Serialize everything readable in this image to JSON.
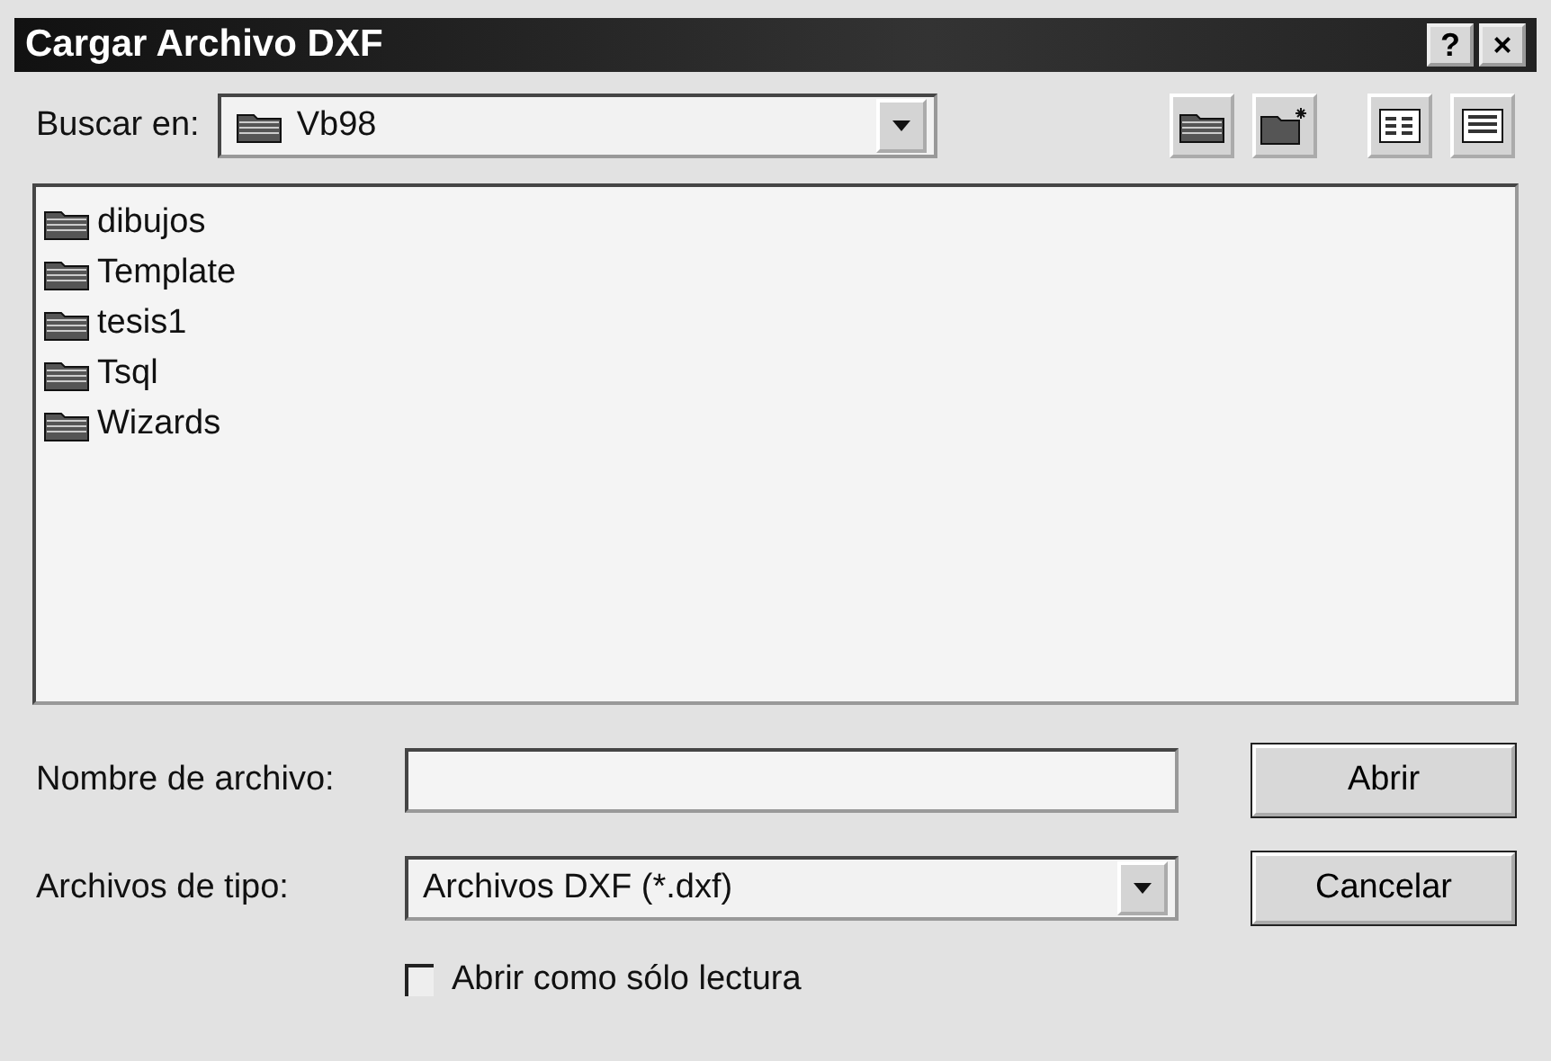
{
  "window": {
    "title": "Cargar Archivo DXF",
    "buttons": [
      "?",
      "×"
    ]
  },
  "look_in": {
    "label": "Buscar en:",
    "value": "Vb98"
  },
  "files": [
    {
      "name": "dibujos"
    },
    {
      "name": "Template"
    },
    {
      "name": "tesis1"
    },
    {
      "name": "Tsql"
    },
    {
      "name": "Wizards"
    }
  ],
  "file_name": {
    "label": "Nombre de archivo:"
  },
  "file_type": {
    "label": "Archivos de tipo:",
    "value": "Archivos DXF (*.dxf)"
  },
  "read_only": {
    "label": "Abrir como sólo lectura",
    "checked": false
  },
  "buttons": [
    "Abrir",
    "Cancelar"
  ]
}
